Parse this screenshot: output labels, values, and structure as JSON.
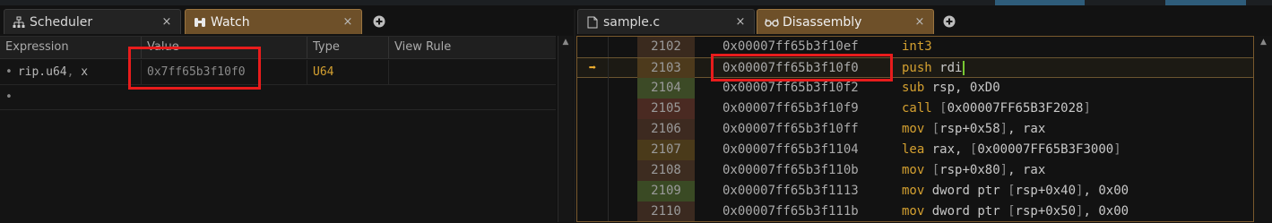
{
  "left_tabs": [
    {
      "label": "Scheduler",
      "icon": "hierarchy-icon",
      "active": false
    },
    {
      "label": "Watch",
      "icon": "binoculars-icon",
      "active": true
    }
  ],
  "right_tabs": [
    {
      "label": "sample.c",
      "icon": "file-icon",
      "active": false
    },
    {
      "label": "Disassembly",
      "icon": "glasses-icon",
      "active": true
    }
  ],
  "tab_close_glyph": "×",
  "add_tab_glyph": "+",
  "watch": {
    "columns": [
      "Expression",
      "Value",
      "Type",
      "View Rule"
    ],
    "rows": [
      {
        "bullet": "•",
        "expr_name": "rip.u64",
        "expr_sep": ",",
        "expr_arg": " x",
        "value": "0x7ff65b3f10f0",
        "type": "U64",
        "view_rule": ""
      },
      {
        "bullet": "•",
        "expr_name": "",
        "expr_sep": "",
        "expr_arg": "",
        "value": "",
        "type": "",
        "view_rule": ""
      }
    ]
  },
  "disassembly": {
    "current_line_marker": "➡",
    "lines": [
      {
        "num": "2102",
        "addr": "0x00007ff65b3f10ef",
        "mnemonic": "int3",
        "operands": "",
        "heat": "#3a2a1e"
      },
      {
        "num": "2103",
        "addr": "0x00007ff65b3f10f0",
        "mnemonic": "push",
        "operands": "rdi",
        "heat": "#4d3a1c",
        "current": true
      },
      {
        "num": "2104",
        "addr": "0x00007ff65b3f10f2",
        "mnemonic": "sub",
        "operands": "rsp, 0xD0",
        "heat": "#3c4a26"
      },
      {
        "num": "2105",
        "addr": "0x00007ff65b3f10f9",
        "mnemonic": "call",
        "operands": "[0x00007FF65B3F2028]",
        "heat": "#4a2a22"
      },
      {
        "num": "2106",
        "addr": "0x00007ff65b3f10ff",
        "mnemonic": "mov",
        "operands": "[rsp+0x58], rax",
        "heat": "#3d2a20"
      },
      {
        "num": "2107",
        "addr": "0x00007ff65b3f1104",
        "mnemonic": "lea",
        "operands": "rax, [0x00007FF65B3F3000]",
        "heat": "#4a3a1a"
      },
      {
        "num": "2108",
        "addr": "0x00007ff65b3f110b",
        "mnemonic": "mov",
        "operands": "[rsp+0x80], rax",
        "heat": "#3d2c20"
      },
      {
        "num": "2109",
        "addr": "0x00007ff65b3f1113",
        "mnemonic": "mov",
        "operands": "dword ptr [rsp+0x40], 0x00",
        "heat": "#3a4a24"
      },
      {
        "num": "2110",
        "addr": "0x00007ff65b3f111b",
        "mnemonic": "mov",
        "operands": "dword ptr [rsp+0x50], 0x00",
        "heat": "#3b2a20"
      }
    ]
  },
  "colors": {
    "active_tab": "#6e5029",
    "mnemonic": "#d4a030",
    "highlight_box": "#e81c1c",
    "caret": "#78c832"
  }
}
